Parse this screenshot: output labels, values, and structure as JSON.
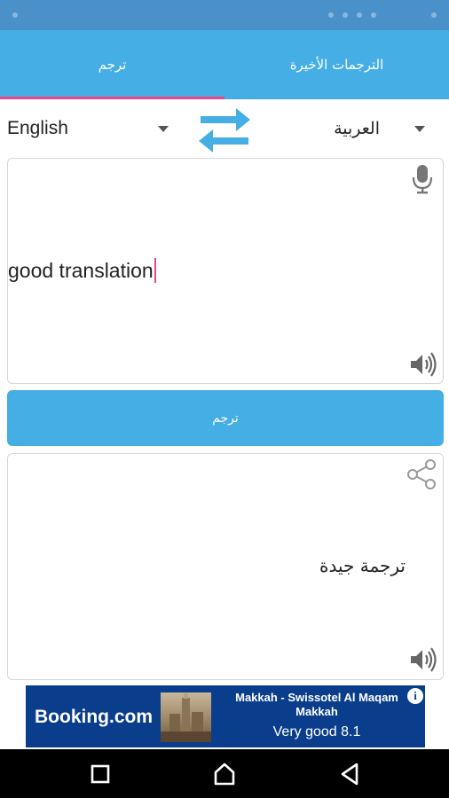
{
  "tabs": {
    "translate_label": "ترجم",
    "recent_label": "الترجمات الأخيرة"
  },
  "languages": {
    "source": "English",
    "target": "العربية"
  },
  "input": {
    "text": "good translation"
  },
  "translate_button": {
    "label": "ترجم"
  },
  "output": {
    "text": "ترجمة جيدة"
  },
  "ad": {
    "brand": "Booking",
    "brand_suffix": ".com",
    "title_line1": "Makkah - Swissotel Al Maqam",
    "title_line2": "Makkah",
    "rating": "Very good 8.1",
    "info_glyph": "i"
  },
  "icons": {
    "swap": "swap-arrows-icon",
    "mic": "microphone-icon",
    "speaker": "speaker-icon",
    "share": "share-icon",
    "nav_recent": "square-icon",
    "nav_home": "home-icon",
    "nav_back": "back-triangle-icon"
  },
  "colors": {
    "primary": "#45aee4",
    "accent": "#e8468a",
    "ad_bg": "#0a3e8c"
  }
}
